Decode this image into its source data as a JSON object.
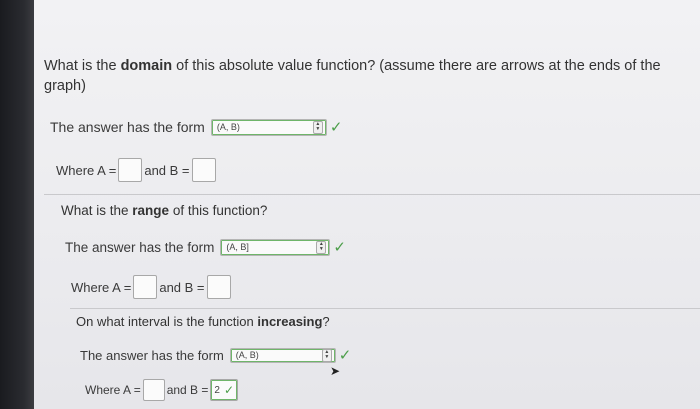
{
  "q1": {
    "text_before": "What is the ",
    "text_bold": "domain",
    "text_after": " of this absolute value function? (assume there are arrows at the ends of the graph)",
    "form_label": "The answer has the form",
    "select_value": "(A, B)",
    "where_a": "Where A =",
    "and_b": "and B ="
  },
  "q2": {
    "text_before": "What is the ",
    "text_bold": "range",
    "text_after": " of this function?",
    "form_label": "The answer has the form",
    "select_value": "(A, B]",
    "where_a": "Where A =",
    "and_b": "and B ="
  },
  "q3": {
    "text_before": "On what interval is the function ",
    "text_bold": "increasing",
    "text_after": "?",
    "form_label": "The answer has the form",
    "select_value": "(A, B)",
    "where_a": "Where A =",
    "and_b": "and B =",
    "b_value": "2"
  },
  "icons": {
    "check": "check-icon",
    "select_arrows": "up-down-arrows-icon",
    "cursor": "mouse-cursor-icon"
  },
  "colors": {
    "correct": "#4c9e4a",
    "bezel": "#1a1b1f"
  }
}
